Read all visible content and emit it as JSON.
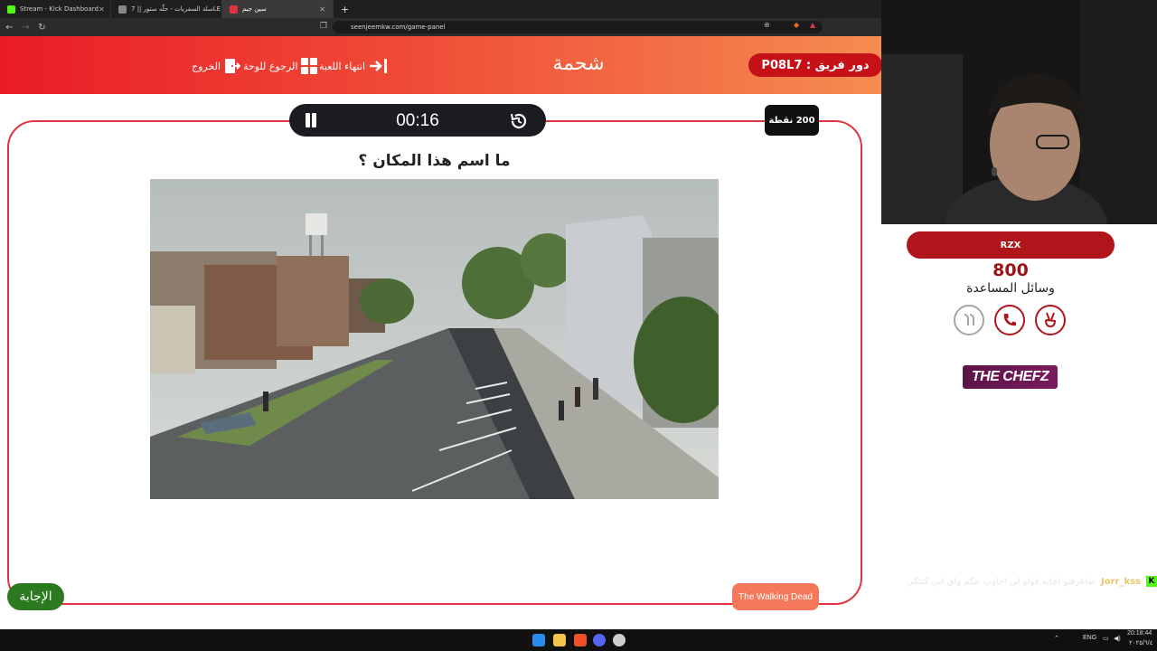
{
  "browser": {
    "tabs": [
      {
        "label": "Stream - Kick Dashboard",
        "color": "#53fc18",
        "active": false
      },
      {
        "label": "سلة السفريات - حلّه ستور || 7LE",
        "color": "#888888",
        "active": false
      },
      {
        "label": "سين جيم",
        "color": "#e0343f",
        "active": true
      }
    ],
    "new_tab": "+",
    "url": "seenjeemkw.com/game-panel"
  },
  "header": {
    "team_turn": "دور فريق : P08L7",
    "category": "شحمة",
    "end_game": "انتهاء اللعبة",
    "back_to_board": "الرجوع للوحة",
    "exit": "الخروج"
  },
  "question_panel": {
    "timer": "00:16",
    "points": "200 نقطة",
    "question": "ما اسم هذا المكان ؟",
    "answer_button": "الإجابة",
    "answer": "The Walking Dead"
  },
  "team_panel": {
    "team_name": "RZX",
    "score": "800",
    "helpers_title": "وسائل المساعدة",
    "helpers": [
      {
        "name": "two-answers",
        "used": true
      },
      {
        "name": "call-a-friend",
        "used": false
      },
      {
        "name": "rest",
        "used": false
      }
    ],
    "sponsor": "THE CHEFZ"
  },
  "chat": {
    "platform": "K",
    "user": "Jorr_kss",
    "message": "ساعرفتو اجابه قولو لي اجاوب عكم واي ابي كتئكي"
  },
  "taskbar": {
    "lang": "ENG",
    "time": "20:18:44",
    "date": "٢٠٢٥/٦/٤"
  },
  "colors": {
    "accent_red": "#e0343f",
    "header_gradient_start": "#ea1c26",
    "header_gradient_end": "#f58c51",
    "answer_green": "#2b7a1f",
    "answer_orange": "#f5785a"
  }
}
